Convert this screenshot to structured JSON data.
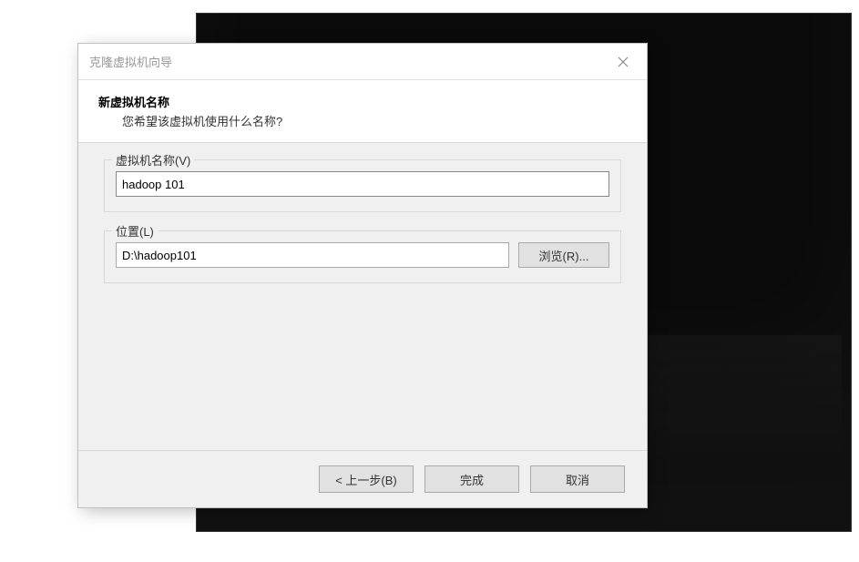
{
  "dialog": {
    "title": "克隆虚拟机向导",
    "header": {
      "title": "新虚拟机名称",
      "subtitle": "您希望该虚拟机使用什么名称?"
    },
    "fields": {
      "vm_name": {
        "label": "虚拟机名称(V)",
        "value": "hadoop 101"
      },
      "location": {
        "label": "位置(L)",
        "value": "D:\\hadoop101",
        "browse_label": "浏览(R)..."
      }
    },
    "footer": {
      "back": "< 上一步(B)",
      "finish": "完成",
      "cancel": "取消"
    }
  }
}
